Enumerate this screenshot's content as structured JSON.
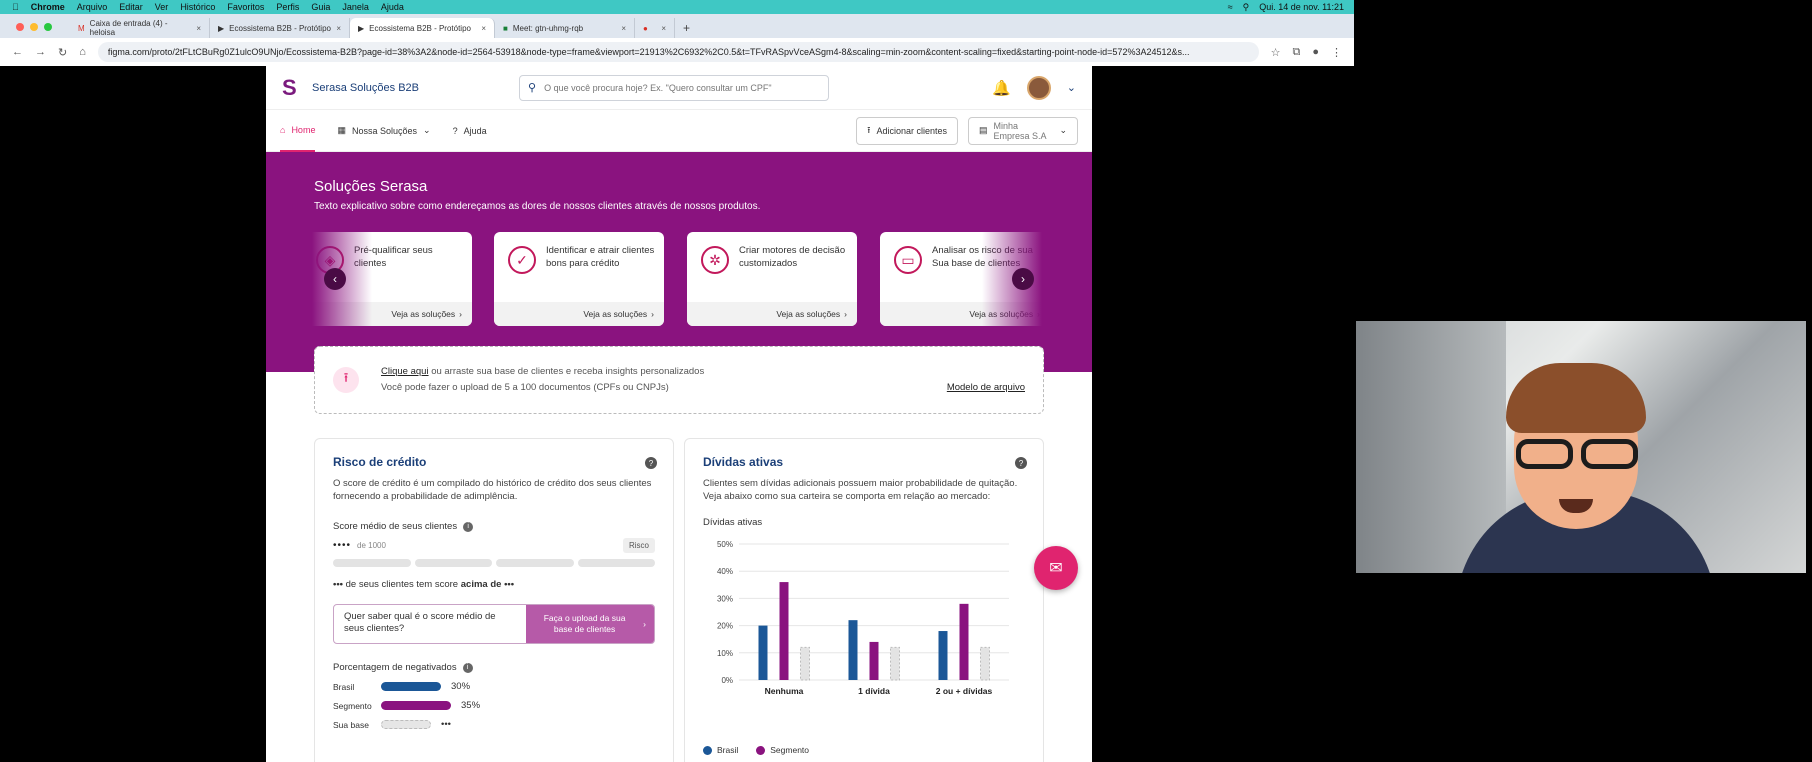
{
  "menubar": {
    "items": [
      "Chrome",
      "Arquivo",
      "Editar",
      "Ver",
      "Histórico",
      "Favoritos",
      "Perfis",
      "Guia",
      "Janela",
      "Ajuda"
    ],
    "clock": "Qui. 14 de nov. 11:21"
  },
  "browser": {
    "tabs": [
      {
        "label": "Caixa de entrada (4) - heloisa"
      },
      {
        "label": "Ecossistema B2B - Protótipo"
      },
      {
        "label": "Ecossistema B2B - Protótipo"
      },
      {
        "label": "Meet: gtn-uhmg-rqb"
      },
      {
        "label": ""
      }
    ],
    "url": "figma.com/proto/2tFLtCBuRg0Z1ulcO9UNjo/Ecossistema-B2B?page-id=38%3A2&node-id=2564-53918&node-type=frame&viewport=21913%2C6932%2C0.5&t=TFvRASpvVceASgm4-8&scaling=min-zoom&content-scaling=fixed&starting-point-node-id=572%3A24512&s..."
  },
  "app": {
    "brand": "Serasa Soluções B2B",
    "search_placeholder": "O que você procura hoje? Ex. \"Quero consultar um CPF\"",
    "nav": {
      "home": "Home",
      "solutions": "Nossa Soluções",
      "help": "Ajuda",
      "add_clients": "Adicionar clientes",
      "company": "Minha Empresa S.A"
    },
    "hero": {
      "title": "Soluções Serasa",
      "subtitle": "Texto explicativo sobre como endereçamos as dores de nossos clientes através de nossos produtos."
    },
    "cards": [
      {
        "title": "Pré-qualificar seus clientes",
        "link": "Veja as soluções"
      },
      {
        "title": "Identificar e atrair clientes bons para crédito",
        "link": "Veja as soluções"
      },
      {
        "title": "Criar motores de decisão customizados",
        "link": "Veja as soluções"
      },
      {
        "title": "Analisar os risco de sua Sua base de clientes",
        "link": "Veja as soluções"
      }
    ],
    "upload": {
      "link": "Clique aqui",
      "text": "ou arraste sua base de clientes e receba insights personalizados",
      "hint": "Você pode fazer o upload de 5 a 100 documentos (CPFs ou CNPJs)",
      "model": "Modelo de arquivo"
    },
    "credit": {
      "title": "Risco de crédito",
      "desc": "O score de crédito é um compilado do histórico de crédito dos seus clientes fornecendo a probabilidade de adimplência.",
      "score_label": "Score médio de seus clientes",
      "score_value": "••••",
      "score_of": "de 1000",
      "risk_tag": "Risco",
      "line_dots": "•••",
      "line_text": "de seus clientes tem score",
      "line_bold": "acima de",
      "line_dots2": "•••",
      "cta_question": "Quer saber qual é o score médio de seus clientes?",
      "cta_button": "Faça o upload da sua base de clientes",
      "neg_label": "Porcentagem de negativados",
      "neg_rows": [
        {
          "label": "Brasil",
          "value": "30%",
          "pct": 30,
          "color": "#1b5797"
        },
        {
          "label": "Segmento",
          "value": "35%",
          "pct": 35,
          "color": "#8a137f"
        },
        {
          "label": "Sua base",
          "value": "•••",
          "pct": 25,
          "color": "#e6e6e6"
        }
      ]
    },
    "debts": {
      "title": "Dívidas ativas",
      "desc": "Clientes sem dívidas adicionais possuem maior probabilidade de quitação. Veja abaixo como sua carteira se comporta em relação ao mercado:",
      "chart_title": "Dívidas ativas"
    }
  },
  "chart_data": {
    "type": "bar",
    "title": "Dívidas ativas",
    "categories": [
      "Nenhuma",
      "1 dívida",
      "2 ou + dívidas"
    ],
    "series": [
      {
        "name": "Brasil",
        "values": [
          20,
          22,
          18
        ],
        "color": "#1b5797"
      },
      {
        "name": "Segmento",
        "values": [
          36,
          14,
          28
        ],
        "color": "#8a137f"
      },
      {
        "values": [
          12,
          12,
          12
        ],
        "color": "#e3e3e3"
      }
    ],
    "ylim": [
      0,
      50
    ],
    "yticks": [
      "0%",
      "10%",
      "20%",
      "30%",
      "40%",
      "50%"
    ],
    "grid": true,
    "legend": "bottom-left"
  }
}
